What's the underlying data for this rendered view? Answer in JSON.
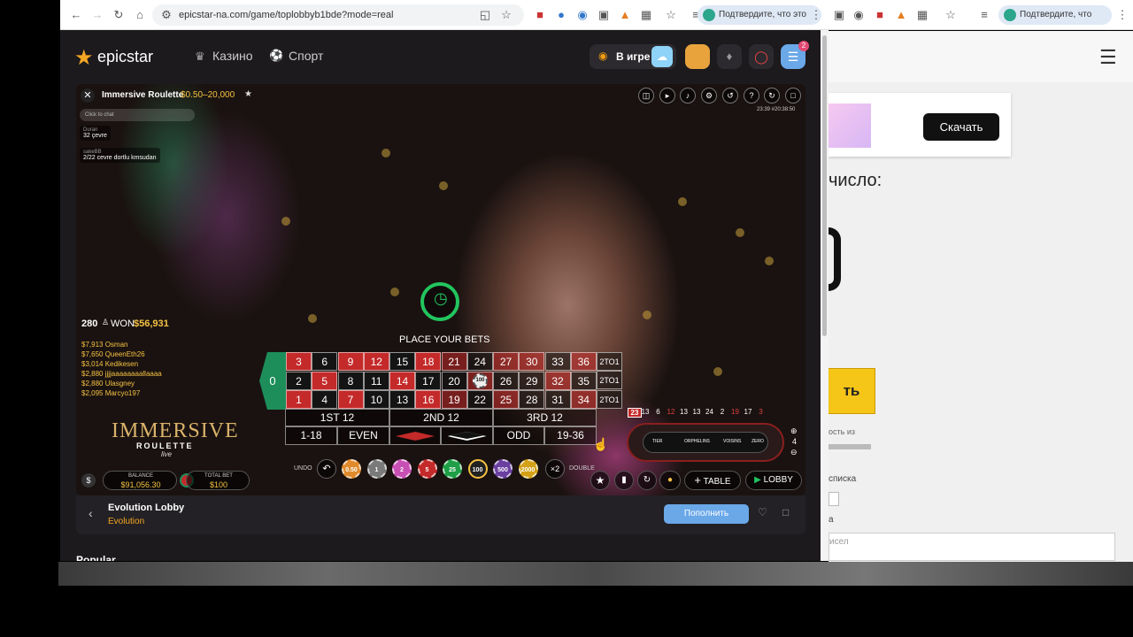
{
  "browser": {
    "url": "epicstar-na.com/game/toplobbyb1bde?mode=real",
    "confirm_left": "Подтвердите, что это вы",
    "confirm_right": "Подтвердите, что это вы"
  },
  "site": {
    "logo": "epicstar",
    "nav": [
      {
        "label": "Казино"
      },
      {
        "label": "Спорт"
      }
    ],
    "in_game": "В игре",
    "badge": "2"
  },
  "game": {
    "title": "Immersive Roulette",
    "limits": "$0.50–20,000",
    "chat_placeholder": "Click to chat",
    "time": "23:39 #20:38:50",
    "chat": [
      {
        "user": "Duran",
        "msg": "32 çevre"
      },
      {
        "user": "sakeBB",
        "msg": "2/22 cevre dortlu kmsudan"
      }
    ],
    "won_count": "280",
    "won_label": "WON",
    "won_amount": "$56,931",
    "winners": [
      "$7,913 Osman",
      "$7,650 QueenEth26",
      "$3,014 Kedikesen",
      "$2,880 jjjjaaaaaaaallaaaa",
      "$2,880 Ulasgney",
      "$2,095 Marcyo197"
    ],
    "logo_line1": "IMMERSIVE",
    "logo_line2": "ROULETTE",
    "logo_line3": "live",
    "place_bets": "PLACE YOUR BETS",
    "zero": "0",
    "rows": [
      [
        {
          "n": "3",
          "c": "red"
        },
        {
          "n": "6",
          "c": "black"
        },
        {
          "n": "9",
          "c": "red"
        },
        {
          "n": "12",
          "c": "red"
        },
        {
          "n": "15",
          "c": "black"
        },
        {
          "n": "18",
          "c": "red"
        },
        {
          "n": "21",
          "c": "fred"
        },
        {
          "n": "24",
          "c": "fblack"
        },
        {
          "n": "27",
          "c": "fred"
        },
        {
          "n": "30",
          "c": "fred"
        },
        {
          "n": "33",
          "c": "fblack"
        },
        {
          "n": "36",
          "c": "fred"
        }
      ],
      [
        {
          "n": "2",
          "c": "black"
        },
        {
          "n": "5",
          "c": "red"
        },
        {
          "n": "8",
          "c": "black"
        },
        {
          "n": "11",
          "c": "black"
        },
        {
          "n": "14",
          "c": "red"
        },
        {
          "n": "17",
          "c": "black"
        },
        {
          "n": "20",
          "c": "fblack"
        },
        {
          "n": "23",
          "c": "fred"
        },
        {
          "n": "26",
          "c": "fblack"
        },
        {
          "n": "29",
          "c": "fblack"
        },
        {
          "n": "32",
          "c": "fred"
        },
        {
          "n": "35",
          "c": "fblack"
        }
      ],
      [
        {
          "n": "1",
          "c": "red"
        },
        {
          "n": "4",
          "c": "black"
        },
        {
          "n": "7",
          "c": "red"
        },
        {
          "n": "10",
          "c": "black"
        },
        {
          "n": "13",
          "c": "black"
        },
        {
          "n": "16",
          "c": "red"
        },
        {
          "n": "19",
          "c": "fred"
        },
        {
          "n": "22",
          "c": "fblack"
        },
        {
          "n": "25",
          "c": "fred"
        },
        {
          "n": "28",
          "c": "fblack"
        },
        {
          "n": "31",
          "c": "fblack"
        },
        {
          "n": "34",
          "c": "fred"
        }
      ]
    ],
    "columns": [
      "2TO1",
      "2TO1",
      "2TO1"
    ],
    "dozens": [
      "1ST 12",
      "2ND 12",
      "3RD 12"
    ],
    "outside": [
      "1-18",
      "EVEN",
      "",
      "",
      "ODD",
      "19-36"
    ],
    "bet_chip": "100",
    "undo": "UNDO",
    "double": "DOUBLE",
    "double_sym": "×2",
    "chips": [
      {
        "v": "0.50",
        "c": "#e08a2c"
      },
      {
        "v": "1",
        "c": "#7a7a7a"
      },
      {
        "v": "2",
        "c": "#c84fb4"
      },
      {
        "v": "5",
        "c": "#c42a2a"
      },
      {
        "v": "25",
        "c": "#1e9e46"
      },
      {
        "v": "100",
        "c": "#222"
      },
      {
        "v": "500",
        "c": "#6a3fa0"
      },
      {
        "v": "2000",
        "c": "#d4a017"
      }
    ],
    "balance_label": "BALANCE",
    "balance": "$91,056.30",
    "total_bet_label": "TOTAL BET",
    "total_bet": "$100",
    "history": [
      "23",
      "13",
      "6",
      "12",
      "13",
      "13",
      "24",
      "2",
      "19",
      "17",
      "3"
    ],
    "last_big": "23",
    "table_btn": "TABLE",
    "lobby_btn": "LOBBY",
    "race_sections": [
      "TIER",
      "ORPHELINS",
      "VOISINS",
      "ZERO"
    ],
    "race_n": "4"
  },
  "lobby": {
    "title": "Evolution Lobby",
    "provider": "Evolution",
    "deposit": "Пополнить"
  },
  "popular": "Popular",
  "right": {
    "download": "Скачать",
    "text1": "число:",
    "text2": "ость из",
    "text3": "списка",
    "text4": "а",
    "text5": "исел",
    "btn": "ть"
  }
}
